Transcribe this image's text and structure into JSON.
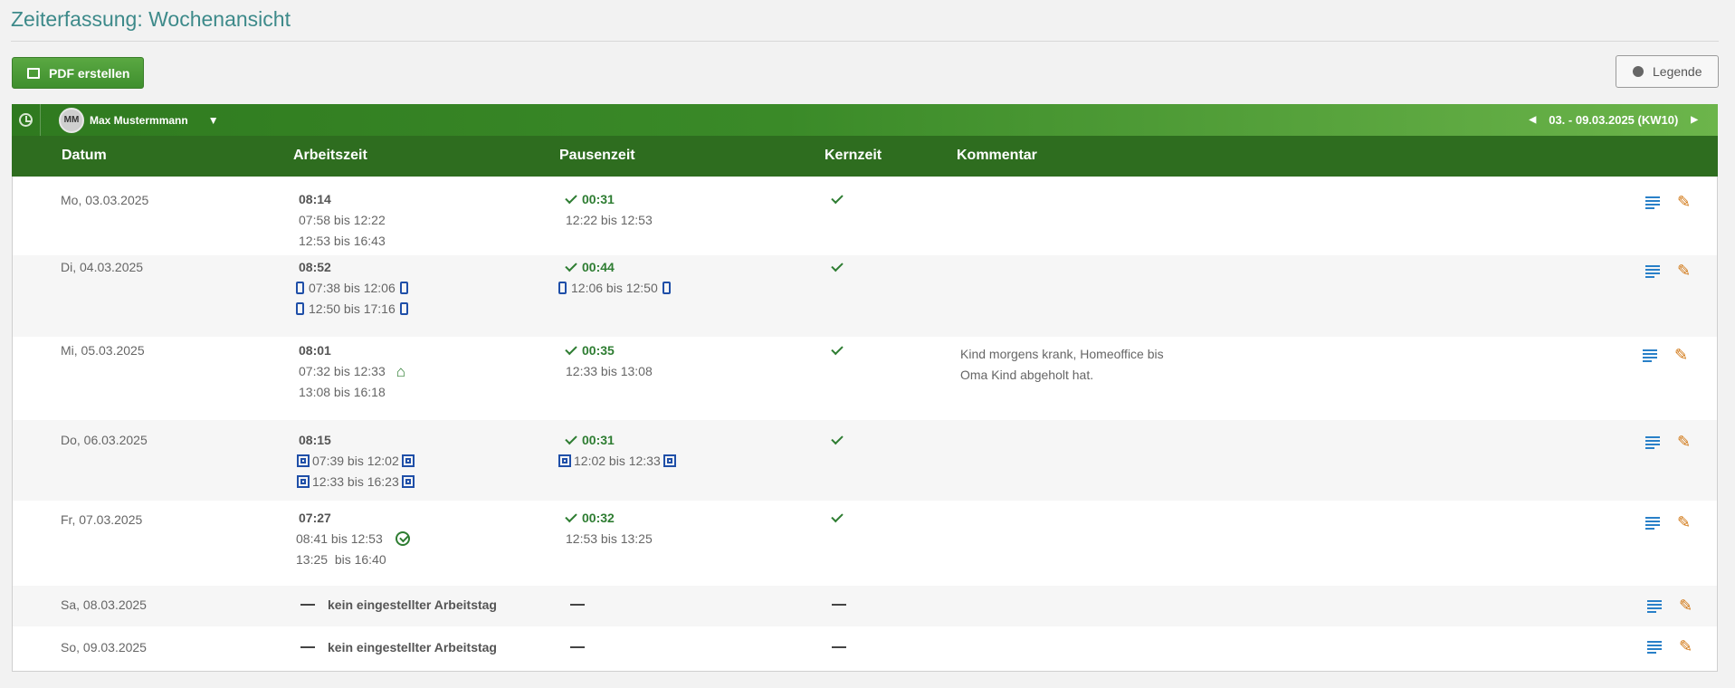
{
  "page": {
    "title": "Zeiterfassung: Wochenansicht"
  },
  "toolbar": {
    "pdf_label": "PDF erstellen",
    "legend_label": "Legende"
  },
  "user": {
    "initials": "MM",
    "name": "Max Mustermmann"
  },
  "week": {
    "label": "03. - 09.03.2025 (KW10)"
  },
  "columns": {
    "datum": "Datum",
    "arbeitszeit": "Arbeitszeit",
    "pausenzeit": "Pausenzeit",
    "kernzeit": "Kernzeit",
    "kommentar": "Kommentar"
  },
  "rows": [
    {
      "date": "Mo, 03.03.2025",
      "work_total": "08:14",
      "work_1": "07:58 bis 12:22",
      "work_2": "12:53 bis 16:43",
      "pause_total": "00:31",
      "pause_1": "12:22 bis 12:53",
      "comment_1": "",
      "comment_2": ""
    },
    {
      "date": "Di, 04.03.2025",
      "work_total": "08:52",
      "work_1": "07:38 bis 12:06",
      "work_2": "12:50 bis 17:16",
      "pause_total": "00:44",
      "pause_1": "12:06 bis 12:50",
      "comment_1": "",
      "comment_2": ""
    },
    {
      "date": "Mi, 05.03.2025",
      "work_total": "08:01",
      "work_1": "07:32 bis 12:33",
      "work_2": "13:08 bis 16:18",
      "pause_total": "00:35",
      "pause_1": "12:33 bis 13:08",
      "comment_1": "Kind morgens krank, Homeoffice bis",
      "comment_2": "Oma Kind abgeholt hat."
    },
    {
      "date": "Do, 06.03.2025",
      "work_total": "08:15",
      "work_1": "07:39 bis 12:02",
      "work_2": "12:33 bis 16:23",
      "pause_total": "00:31",
      "pause_1": "12:02 bis 12:33",
      "comment_1": "",
      "comment_2": ""
    },
    {
      "date": "Fr, 07.03.2025",
      "work_total": "07:27",
      "work_1": "08:41 bis 12:53",
      "work_2": "13:25  bis 16:40",
      "pause_total": "00:32",
      "pause_1": "12:53 bis 13:25",
      "comment_1": "",
      "comment_2": ""
    },
    {
      "date": "Sa, 08.03.2025",
      "no_workday": "kein eingestellter Arbeitstag"
    },
    {
      "date": "So, 09.03.2025",
      "no_workday": "kein eingestellter Arbeitstag"
    }
  ],
  "icons": {
    "details": "details-list-icon",
    "edit": "edit-pencil-icon",
    "phone": "mobile-phone-icon",
    "card": "terminal-card-icon",
    "home": "home-office-icon",
    "verified": "verified-check-icon"
  },
  "colors": {
    "header_green": "#2e6d1f",
    "title_teal": "#3d8a8a",
    "accent_orange": "#d0740f",
    "accent_blue": "#1f4fa8"
  }
}
